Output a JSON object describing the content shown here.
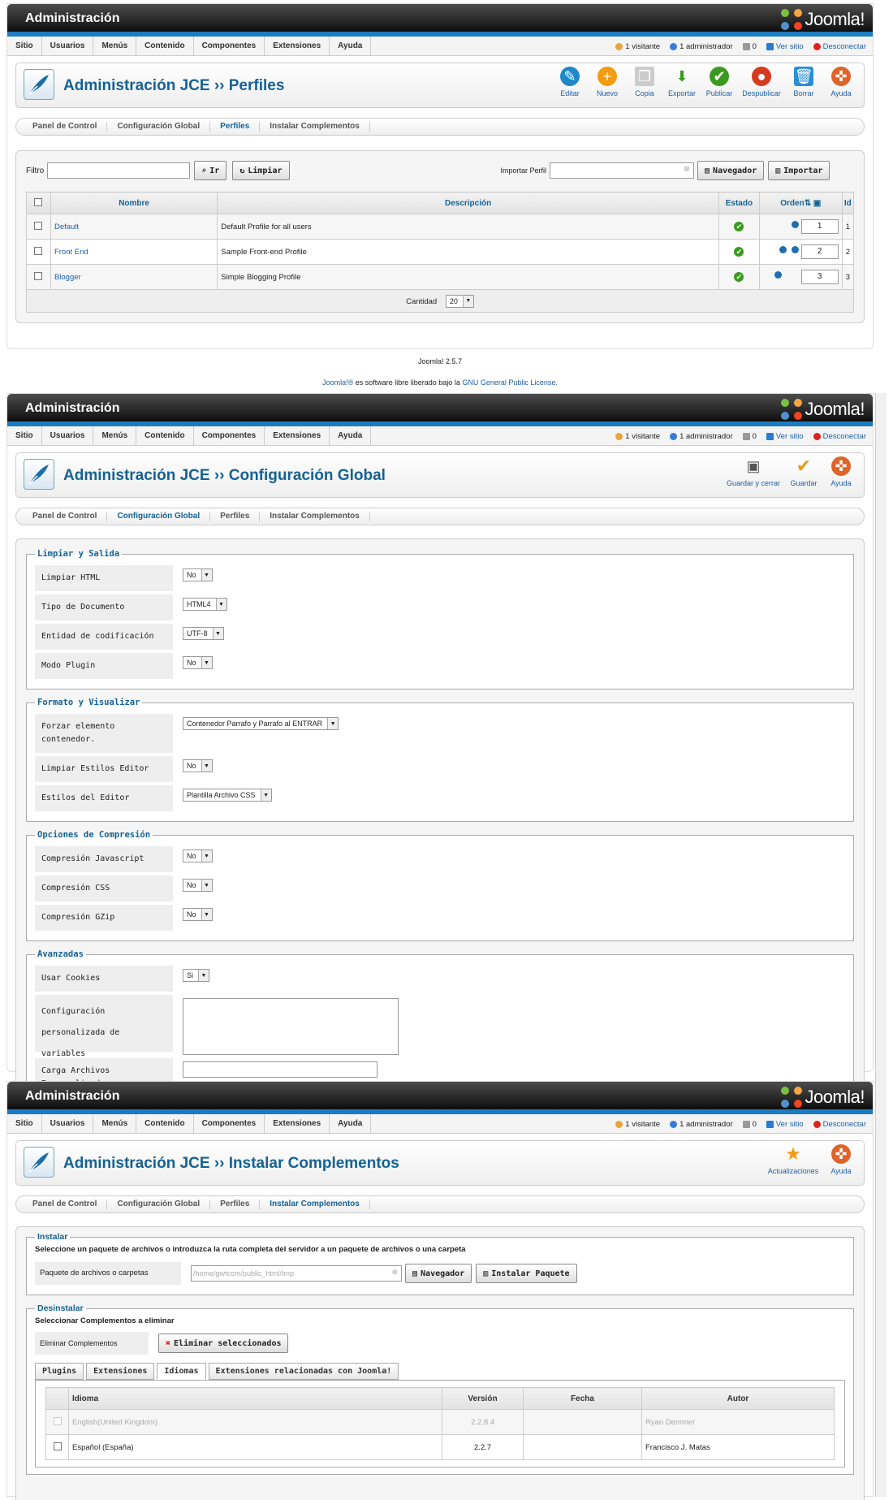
{
  "header": {
    "title": "Administración",
    "logo_text": "Joomla!"
  },
  "menu": [
    "Sitio",
    "Usuarios",
    "Menús",
    "Contenido",
    "Componentes",
    "Extensiones",
    "Ayuda"
  ],
  "status": {
    "visitors": "1 visitante",
    "admins": "1 administrador",
    "messages": "0",
    "view_site": "Ver sitio",
    "logout": "Desconectar"
  },
  "subnav": [
    "Panel de Control",
    "Configuración Global",
    "Perfiles",
    "Instalar Complementos"
  ],
  "screen1": {
    "title": "Administración JCE ›› Perfiles",
    "buttons": [
      {
        "label": "Editar",
        "icon": "edit-icon",
        "color": "#1e88c8",
        "glyph": "✎"
      },
      {
        "label": "Nuevo",
        "icon": "new-icon",
        "color": "#f39c12",
        "glyph": "+"
      },
      {
        "label": "Copia",
        "icon": "copy-icon",
        "color": "#bbbbbb",
        "glyph": "❐"
      },
      {
        "label": "Exportar",
        "icon": "export-icon",
        "color": "#3a9a1f",
        "glyph": "⬇"
      },
      {
        "label": "Publicar",
        "icon": "publish-icon",
        "color": "#3a9a1f",
        "glyph": "✔"
      },
      {
        "label": "Despublicar",
        "icon": "unpublish-icon",
        "color": "#d63a1e",
        "glyph": "●"
      },
      {
        "label": "Borrar",
        "icon": "trash-icon",
        "color": "#2b8fd6",
        "glyph": "🗑"
      },
      {
        "label": "Ayuda",
        "icon": "help-icon",
        "color": "#e0632a",
        "glyph": "✜"
      }
    ],
    "filter_label": "Filtro",
    "go_label": "Ir",
    "clear_label": "Limpiar",
    "import_label": "Importar Perfil",
    "browse_label": "Navegador",
    "import_btn": "Importar",
    "columns": {
      "name": "Nombre",
      "desc": "Descripción",
      "state": "Estado",
      "order": "Orden",
      "id": "Id"
    },
    "rows": [
      {
        "name": "Default",
        "desc": "Default Profile for all users",
        "order": "1",
        "id": "1"
      },
      {
        "name": "Front End",
        "desc": "Sample Front-end Profile",
        "order": "2",
        "id": "2"
      },
      {
        "name": "Blogger",
        "desc": "Simple Blogging Profile",
        "order": "3",
        "id": "3"
      }
    ],
    "qty_label": "Cantidad",
    "qty_value": "20",
    "version": "Joomla! 2.5.7",
    "license_a": "Joomla!®",
    "license_b": " es software libre liberado bajo la ",
    "license_c": "GNU General Public License."
  },
  "screen2": {
    "title": "Administración JCE ›› Configuración Global",
    "buttons": [
      {
        "label": "Guardar y cerrar",
        "icon": "save-icon"
      },
      {
        "label": "Guardar",
        "icon": "check-icon"
      },
      {
        "label": "Ayuda",
        "icon": "help-icon"
      }
    ],
    "sections": [
      {
        "legend": "Limpiar y Salida",
        "fields": [
          {
            "label": "Limpiar HTML",
            "value": "No"
          },
          {
            "label": "Tipo de Documento",
            "value": "HTML4"
          },
          {
            "label": "Entidad de codificación",
            "value": "UTF-8"
          },
          {
            "label": "Modo Plugin",
            "value": "No"
          }
        ]
      },
      {
        "legend": "Formato y Visualizar",
        "fields": [
          {
            "label": "Forzar elemento contenedor.",
            "value": "Contenedor Parrafo y Parrafo al ENTRAR"
          },
          {
            "label": "Limpiar Estilos Editor",
            "value": "No"
          },
          {
            "label": "Estilos del Editor",
            "value": "Plantilla Archivo CSS"
          }
        ]
      },
      {
        "legend": "Opciones de Compresión",
        "fields": [
          {
            "label": "Compresión Javascript",
            "value": "No"
          },
          {
            "label": "Compresión CSS",
            "value": "No"
          },
          {
            "label": "Compresión GZip",
            "value": "No"
          }
        ]
      }
    ],
    "advanced": {
      "legend": "Avanzadas",
      "cookies_label": "Usar Cookies",
      "cookies_value": "Si",
      "vars_label": "Configuración personalizada de variables",
      "files_label": "Carga Archivos Personalizados"
    }
  },
  "screen3": {
    "title": "Administración JCE ›› Instalar Complementos",
    "buttons": [
      {
        "label": "Actualizaciones",
        "icon": "star-icon"
      },
      {
        "label": "Ayuda",
        "icon": "help-icon"
      }
    ],
    "install_legend": "Instalar",
    "install_desc": "Seleccione un paquete de archivos o introduzca la ruta completa del servidor a un paquete de archivos o una carpeta",
    "package_label": "Paquete de archivos o carpetas",
    "package_placeholder": "/home/gwtcom/public_html/tmp",
    "browse_label": "Navegador",
    "install_btn": "Instalar Paquete",
    "uninstall_legend": "Desinstalar",
    "uninstall_desc": "Seleccionar Complementos a eliminar",
    "remove_label": "Eliminar Complementos",
    "remove_btn": "Eliminar seleccionados",
    "tabs": [
      "Plugins",
      "Extensiones",
      "Idiomas",
      "Extensiones relacionadas con Joomla!"
    ],
    "columns": {
      "lang": "Idioma",
      "version": "Versión",
      "date": "Fecha",
      "author": "Autor"
    },
    "rows": [
      {
        "lang": "English(United Kingdom)",
        "version": "2.2.8.4",
        "date": "",
        "author": "Ryan Demmer"
      },
      {
        "lang": "Español (España)",
        "version": "2.2.7",
        "date": "",
        "author": "Francisco J. Matas"
      }
    ]
  }
}
